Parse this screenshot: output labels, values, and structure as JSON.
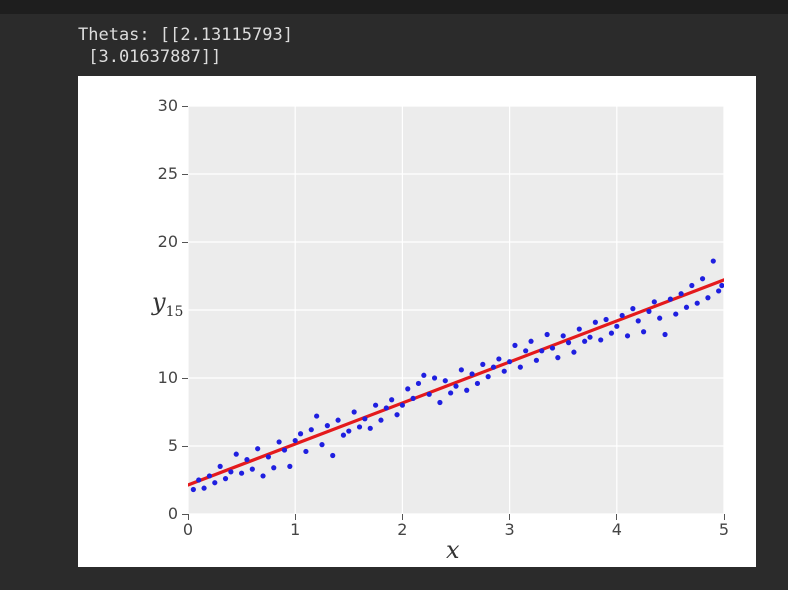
{
  "output": {
    "line1": "Thetas: [[2.13115793]",
    "line2": " [3.01637887]]"
  },
  "chart_data": {
    "type": "scatter+line",
    "xlabel": "x",
    "ylabel": "y",
    "xlim": [
      0,
      5
    ],
    "ylim": [
      0,
      30
    ],
    "xticks": [
      0,
      1,
      2,
      3,
      4,
      5
    ],
    "yticks": [
      0,
      5,
      10,
      15,
      20,
      25,
      30
    ],
    "line": {
      "intercept": 2.13115793,
      "slope": 3.01637887,
      "x0": 0,
      "x1": 5,
      "color": "#e41a1c"
    },
    "scatter": {
      "color": "#1f1fe0",
      "points": [
        [
          0.05,
          1.8
        ],
        [
          0.1,
          2.5
        ],
        [
          0.15,
          1.9
        ],
        [
          0.2,
          2.8
        ],
        [
          0.25,
          2.3
        ],
        [
          0.3,
          3.5
        ],
        [
          0.35,
          2.6
        ],
        [
          0.4,
          3.1
        ],
        [
          0.45,
          4.4
        ],
        [
          0.5,
          3.0
        ],
        [
          0.55,
          4.0
        ],
        [
          0.6,
          3.3
        ],
        [
          0.65,
          4.8
        ],
        [
          0.7,
          2.8
        ],
        [
          0.75,
          4.2
        ],
        [
          0.8,
          3.4
        ],
        [
          0.85,
          5.3
        ],
        [
          0.9,
          4.7
        ],
        [
          0.95,
          3.5
        ],
        [
          1.0,
          5.4
        ],
        [
          1.05,
          5.9
        ],
        [
          1.1,
          4.6
        ],
        [
          1.15,
          6.2
        ],
        [
          1.2,
          7.2
        ],
        [
          1.25,
          5.1
        ],
        [
          1.3,
          6.5
        ],
        [
          1.35,
          4.3
        ],
        [
          1.4,
          6.9
        ],
        [
          1.45,
          5.8
        ],
        [
          1.5,
          6.1
        ],
        [
          1.55,
          7.5
        ],
        [
          1.6,
          6.4
        ],
        [
          1.65,
          7.0
        ],
        [
          1.7,
          6.3
        ],
        [
          1.75,
          8.0
        ],
        [
          1.8,
          6.9
        ],
        [
          1.85,
          7.8
        ],
        [
          1.9,
          8.4
        ],
        [
          1.95,
          7.3
        ],
        [
          2.0,
          8.0
        ],
        [
          2.05,
          9.2
        ],
        [
          2.1,
          8.5
        ],
        [
          2.15,
          9.6
        ],
        [
          2.2,
          10.2
        ],
        [
          2.25,
          8.8
        ],
        [
          2.3,
          10.0
        ],
        [
          2.35,
          8.2
        ],
        [
          2.4,
          9.8
        ],
        [
          2.45,
          8.9
        ],
        [
          2.5,
          9.4
        ],
        [
          2.55,
          10.6
        ],
        [
          2.6,
          9.1
        ],
        [
          2.65,
          10.3
        ],
        [
          2.7,
          9.6
        ],
        [
          2.75,
          11.0
        ],
        [
          2.8,
          10.1
        ],
        [
          2.85,
          10.8
        ],
        [
          2.9,
          11.4
        ],
        [
          2.95,
          10.5
        ],
        [
          3.0,
          11.2
        ],
        [
          3.05,
          12.4
        ],
        [
          3.1,
          10.8
        ],
        [
          3.15,
          12.0
        ],
        [
          3.2,
          12.7
        ],
        [
          3.25,
          11.3
        ],
        [
          3.3,
          12.0
        ],
        [
          3.35,
          13.2
        ],
        [
          3.4,
          12.2
        ],
        [
          3.45,
          11.5
        ],
        [
          3.5,
          13.1
        ],
        [
          3.55,
          12.6
        ],
        [
          3.6,
          11.9
        ],
        [
          3.65,
          13.6
        ],
        [
          3.7,
          12.7
        ],
        [
          3.75,
          13.0
        ],
        [
          3.8,
          14.1
        ],
        [
          3.85,
          12.8
        ],
        [
          3.9,
          14.3
        ],
        [
          3.95,
          13.3
        ],
        [
          4.0,
          13.8
        ],
        [
          4.05,
          14.6
        ],
        [
          4.1,
          13.1
        ],
        [
          4.15,
          15.1
        ],
        [
          4.2,
          14.2
        ],
        [
          4.25,
          13.4
        ],
        [
          4.3,
          14.9
        ],
        [
          4.35,
          15.6
        ],
        [
          4.4,
          14.4
        ],
        [
          4.45,
          13.2
        ],
        [
          4.5,
          15.8
        ],
        [
          4.55,
          14.7
        ],
        [
          4.6,
          16.2
        ],
        [
          4.65,
          15.2
        ],
        [
          4.7,
          16.8
        ],
        [
          4.75,
          15.5
        ],
        [
          4.8,
          17.3
        ],
        [
          4.85,
          15.9
        ],
        [
          4.9,
          18.6
        ],
        [
          4.95,
          16.4
        ],
        [
          4.98,
          16.8
        ]
      ]
    }
  }
}
